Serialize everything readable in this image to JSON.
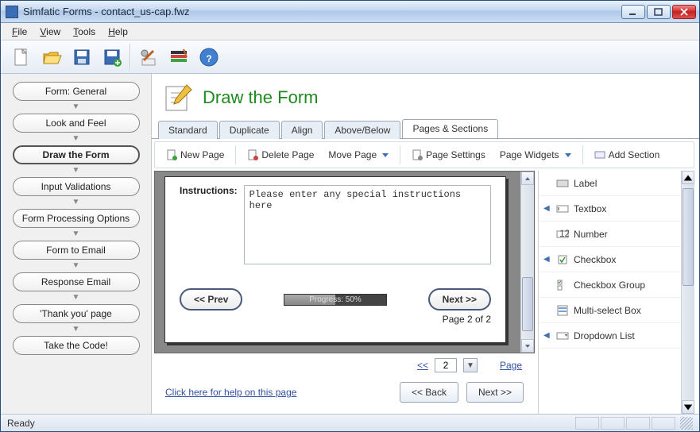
{
  "window": {
    "title": "Simfatic Forms - contact_us-cap.fwz"
  },
  "menu": {
    "file": "File",
    "view": "View",
    "tools": "Tools",
    "help": "Help"
  },
  "sidebar": {
    "items": [
      {
        "label": "Form: General"
      },
      {
        "label": "Look and Feel"
      },
      {
        "label": "Draw the Form"
      },
      {
        "label": "Input Validations"
      },
      {
        "label": "Form Processing Options"
      },
      {
        "label": "Form to Email"
      },
      {
        "label": "Response Email"
      },
      {
        "label": "'Thank you' page"
      },
      {
        "label": "Take the Code!"
      }
    ],
    "active_index": 2
  },
  "page": {
    "title": "Draw the Form",
    "tabs": [
      "Standard",
      "Duplicate",
      "Align",
      "Above/Below",
      "Pages & Sections"
    ],
    "active_tab": 4,
    "subtoolbar": {
      "new_page": "New Page",
      "delete_page": "Delete Page",
      "move_page": "Move Page",
      "page_settings": "Page Settings",
      "page_widgets": "Page Widgets",
      "add_section": "Add Section"
    },
    "form": {
      "instructions_label": "Instructions:",
      "instructions_value": "Please enter any special instructions here",
      "prev": "<< Prev",
      "next": "Next >>",
      "progress_label": "Progress: 50%",
      "page_indicator": "Page 2 of 2"
    },
    "pager": {
      "prev": "<<",
      "value": "2",
      "next_sym": "▼",
      "link": "Page"
    },
    "palette": [
      {
        "label": "Label",
        "expand": ""
      },
      {
        "label": "Textbox",
        "expand": "◀"
      },
      {
        "label": "Number",
        "expand": ""
      },
      {
        "label": "Checkbox",
        "expand": "◀"
      },
      {
        "label": "Checkbox Group",
        "expand": ""
      },
      {
        "label": "Multi-select Box",
        "expand": ""
      },
      {
        "label": "Dropdown List",
        "expand": "◀"
      }
    ],
    "help_link": "Click here for help on this page",
    "back": "<< Back",
    "next": "Next >>"
  },
  "status": {
    "ready": "Ready"
  }
}
